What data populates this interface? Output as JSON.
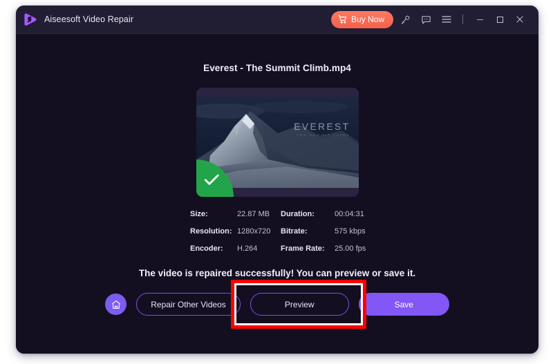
{
  "window": {
    "titlebar": {
      "app_title": "Aiseesoft Video Repair",
      "logo_icon": "aiseesoft-play-logo",
      "buy_now_label": "Buy Now",
      "buy_now_icon": "shopping-cart-icon",
      "buy_now_color": "#f4604a",
      "key_icon": "key-icon",
      "feedback_icon": "chat-bubble-icon",
      "menu_icon": "hamburger-menu-icon",
      "minimize_icon": "minimize-icon",
      "maximize_icon": "maximize-icon",
      "close_icon": "close-icon"
    },
    "background_color": "#130f21"
  },
  "main": {
    "file_name": "Everest - The Summit Climb.mp4",
    "thumbnail": {
      "overlay_title": "EVEREST",
      "overlay_subtitle": "THE SUMMIT CLIMB",
      "status_badge_icon": "green-check-badge",
      "status_badge_color": "#22a44a"
    },
    "details": [
      {
        "key": "Size:",
        "value": "22.87 MB",
        "key2": "Duration:",
        "value2": "00:04:31"
      },
      {
        "key": "Resolution:",
        "value": "1280x720",
        "key2": "Bitrate:",
        "value2": "575 kbps"
      },
      {
        "key": "Encoder:",
        "value": "H.264",
        "key2": "Frame Rate:",
        "value2": "25.00 fps"
      }
    ],
    "success_message": "The video is repaired successfully! You can preview or save it.",
    "actions": {
      "home_icon": "home-icon",
      "repair_other_label": "Repair Other Videos",
      "preview_label": "Preview",
      "save_label": "Save",
      "save_color": "#8257f6",
      "highlight_color": "#fe0000"
    }
  }
}
